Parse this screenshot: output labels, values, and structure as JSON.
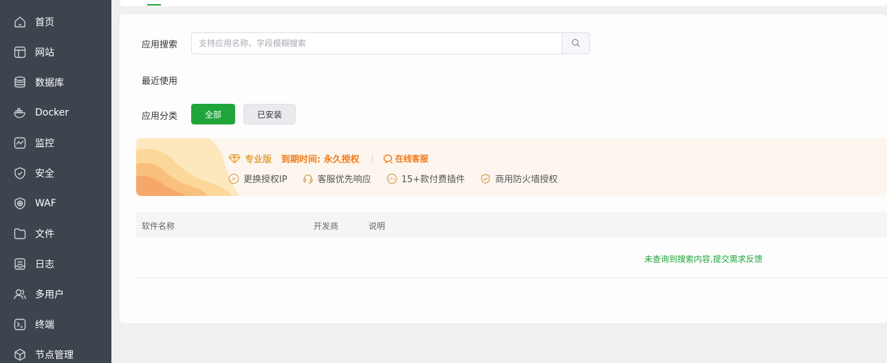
{
  "sidebar": {
    "items": [
      {
        "label": "首页",
        "icon": "home-icon"
      },
      {
        "label": "网站",
        "icon": "website-icon"
      },
      {
        "label": "数据库",
        "icon": "database-icon"
      },
      {
        "label": "Docker",
        "icon": "docker-icon"
      },
      {
        "label": "监控",
        "icon": "monitor-icon"
      },
      {
        "label": "安全",
        "icon": "shield-icon"
      },
      {
        "label": "WAF",
        "icon": "waf-icon"
      },
      {
        "label": "文件",
        "icon": "folder-icon"
      },
      {
        "label": "日志",
        "icon": "log-icon"
      },
      {
        "label": "多用户",
        "icon": "users-icon"
      },
      {
        "label": "终端",
        "icon": "terminal-icon"
      },
      {
        "label": "节点管理",
        "icon": "node-icon"
      }
    ]
  },
  "search": {
    "label": "应用搜索",
    "placeholder": "支持应用名称、字段模糊搜索",
    "value": ""
  },
  "recent": {
    "label": "最近使用"
  },
  "category": {
    "label": "应用分类",
    "all": "全部",
    "installed": "已安装"
  },
  "promo": {
    "edition": "专业版",
    "expiry": "到期时间: 永久授权",
    "support": "在线客服",
    "features": [
      "更换授权IP",
      "客服优先响应",
      "15+款付费插件",
      "商用防火墙授权"
    ],
    "colors": {
      "accent": "#e6a23c",
      "expiry": "#f07a1a"
    }
  },
  "table": {
    "columns": [
      "软件名称",
      "开发商",
      "说明"
    ],
    "empty_text": "未查询到搜索内容,提交需求反馈"
  },
  "colors": {
    "brand": "#20a53a",
    "sidebar_bg": "#3c444d"
  }
}
